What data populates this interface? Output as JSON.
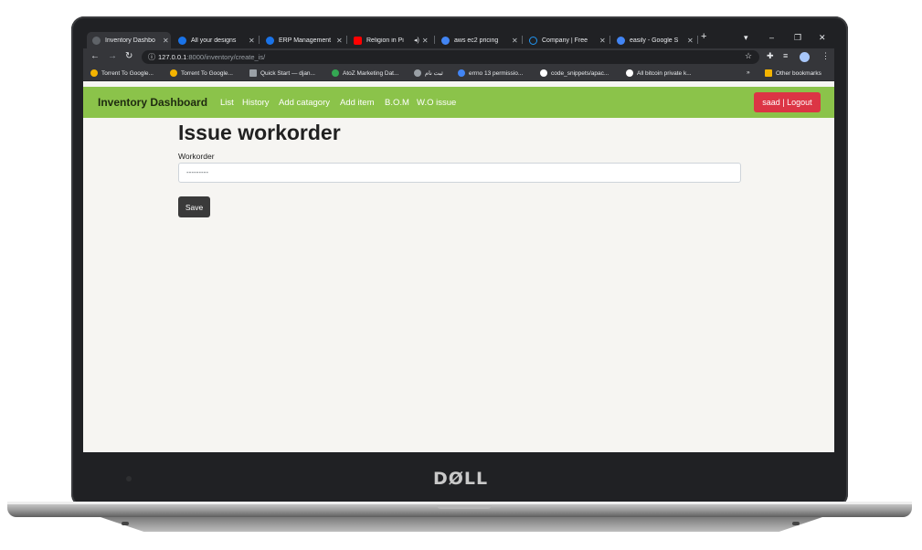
{
  "browser": {
    "tabs": [
      {
        "title": "Inventory Dashbo",
        "favicon_color": "#5f6368",
        "active": true
      },
      {
        "title": "All your designs",
        "favicon_color": "#1a73e8"
      },
      {
        "title": "ERP Management",
        "favicon_color": "#1a73e8"
      },
      {
        "title": "Religion in Pi",
        "favicon_color": "#ff0000"
      },
      {
        "title": "aws ec2 pricing",
        "favicon_color": "#4285f4"
      },
      {
        "title": "Company | Free",
        "favicon_color": "#2196f3"
      },
      {
        "title": "easily - Google S",
        "favicon_color": "#4285f4"
      }
    ],
    "close_glyph": "✕",
    "new_tab_glyph": "+",
    "url_host": "127.0.0.1",
    "url_path": ":8000/inventory/create_is/",
    "bookmarks": [
      {
        "label": "Torrent To Google...",
        "icon_color": "#f4b400"
      },
      {
        "label": "Torrent To Google...",
        "icon_color": "#f4b400"
      },
      {
        "label": "Quick Start — djan...",
        "icon_color": "#9aa0a6"
      },
      {
        "label": "AtoZ Marketing Dat...",
        "icon_color": "#34a853"
      },
      {
        "label": "ثبت نام",
        "icon_color": "#9aa0a6"
      },
      {
        "label": "errno 13 permissio...",
        "icon_color": "#4285f4"
      },
      {
        "label": "code_snippets/apac...",
        "icon_color": "#ffffff"
      },
      {
        "label": "All bitcoin private k...",
        "icon_color": "#ffffff"
      }
    ],
    "bookmarks_overflow": "»",
    "other_bookmarks": "Other bookmarks"
  },
  "navbar": {
    "brand": "Inventory Dashboard",
    "links": [
      "List",
      "History",
      "Add catagory",
      "Add item",
      "B.O.M",
      "W.O issue"
    ],
    "logout_label": "saad | Logout",
    "bg_color": "#8bc34a",
    "logout_color": "#dc3545"
  },
  "form": {
    "title": "Issue workorder",
    "workorder_label": "Workorder",
    "workorder_value": "---------",
    "save_label": "Save"
  },
  "laptop": {
    "brand": "DØLL"
  }
}
